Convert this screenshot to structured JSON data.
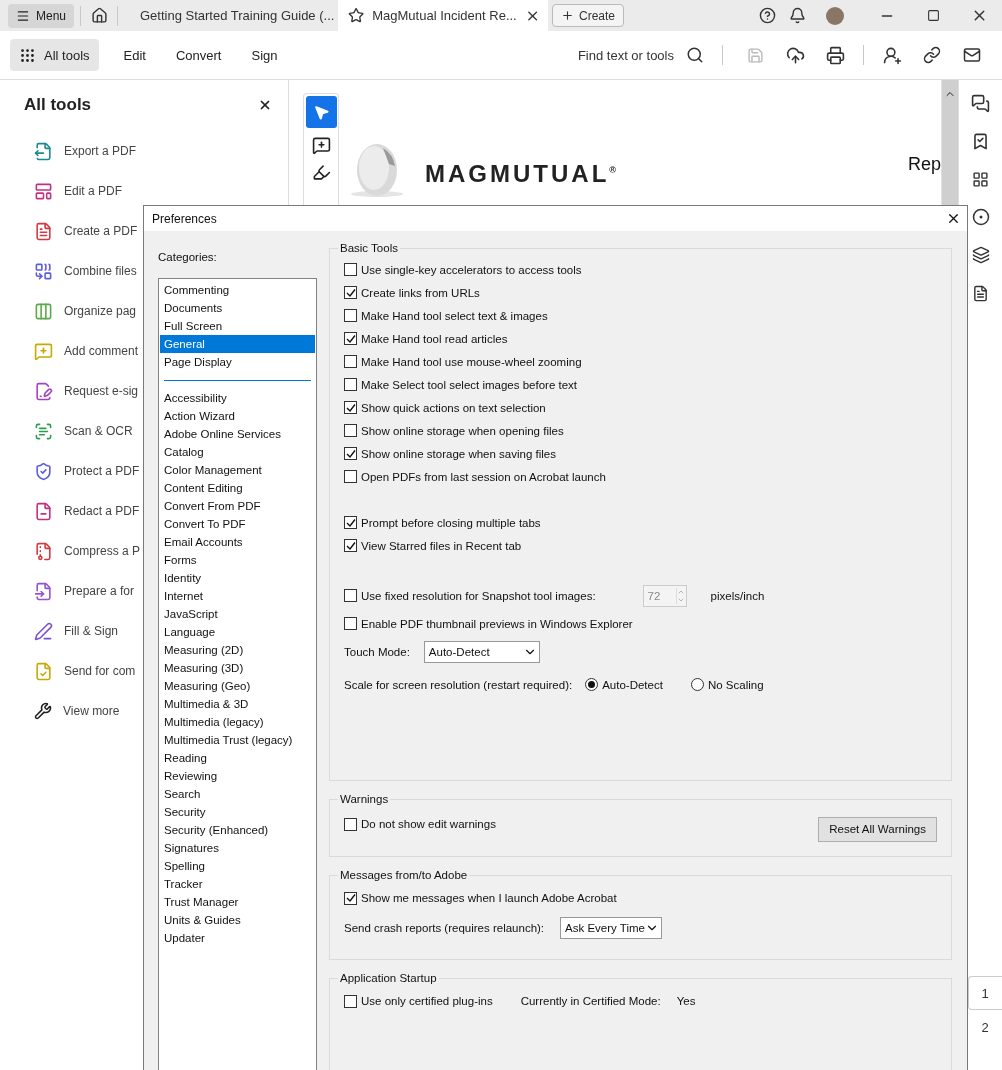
{
  "tab_bar": {
    "menu": "Menu",
    "tabs": [
      {
        "title": "Getting Started Training Guide (...",
        "selected": false
      },
      {
        "title": "MagMutual Incident Re...",
        "selected": true
      }
    ],
    "create": "Create"
  },
  "toolbar": {
    "items": [
      {
        "label": "All tools",
        "selected": true
      },
      {
        "label": "Edit",
        "selected": false
      },
      {
        "label": "Convert",
        "selected": false
      },
      {
        "label": "Sign",
        "selected": false
      }
    ],
    "search": "Find text or tools"
  },
  "tools_panel": {
    "title": "All tools",
    "items": [
      {
        "label": "Export a PDF",
        "color": "#1b8a8f"
      },
      {
        "label": "Edit a PDF",
        "color": "#c2307f"
      },
      {
        "label": "Create a PDF",
        "color": "#d7373f"
      },
      {
        "label": "Combine files",
        "color": "#5c5ce0"
      },
      {
        "label": "Organize pag",
        "color": "#5aa847"
      },
      {
        "label": "Add comment",
        "color": "#c9a800"
      },
      {
        "label": "Request e-sig",
        "color": "#a341c9"
      },
      {
        "label": "Scan & OCR",
        "color": "#2d9d4a"
      },
      {
        "label": "Protect a PDF",
        "color": "#5c5ce0"
      },
      {
        "label": "Redact a PDF",
        "color": "#c2307f"
      },
      {
        "label": "Compress a P",
        "color": "#d7373f"
      },
      {
        "label": "Prepare a for",
        "color": "#9353d3"
      },
      {
        "label": "Fill & Sign",
        "color": "#7a4fd6"
      },
      {
        "label": "Send for com",
        "color": "#c9a800"
      }
    ],
    "view_more": "View more"
  },
  "document": {
    "logo": "MAGMUTUAL$^{®}$",
    "heading": "Rep"
  },
  "page_numbers": [
    {
      "label": "1",
      "selected": true
    },
    {
      "label": "2",
      "selected": false
    }
  ],
  "dialog": {
    "title": "Preferences",
    "categories_label": "Categories:",
    "category_groups": [
      {
        "items": [
          {
            "label": "Commenting",
            "selected": false
          },
          {
            "label": "Documents",
            "selected": false
          },
          {
            "label": "Full Screen",
            "selected": false
          },
          {
            "label": "General",
            "selected": true
          },
          {
            "label": "Page Display",
            "selected": false
          }
        ]
      },
      {
        "items": [
          {
            "label": "Accessibility",
            "selected": false
          },
          {
            "label": "Action Wizard",
            "selected": false
          },
          {
            "label": "Adobe Online Services",
            "selected": false
          },
          {
            "label": "Catalog",
            "selected": false
          },
          {
            "label": "Color Management",
            "selected": false
          },
          {
            "label": "Content Editing",
            "selected": false
          },
          {
            "label": "Convert From PDF",
            "selected": false
          },
          {
            "label": "Convert To PDF",
            "selected": false
          },
          {
            "label": "Email Accounts",
            "selected": false
          },
          {
            "label": "Forms",
            "selected": false
          },
          {
            "label": "Identity",
            "selected": false
          },
          {
            "label": "Internet",
            "selected": false
          },
          {
            "label": "JavaScript",
            "selected": false
          },
          {
            "label": "Language",
            "selected": false
          },
          {
            "label": "Measuring (2D)",
            "selected": false
          },
          {
            "label": "Measuring (3D)",
            "selected": false
          },
          {
            "label": "Measuring (Geo)",
            "selected": false
          },
          {
            "label": "Multimedia & 3D",
            "selected": false
          },
          {
            "label": "Multimedia (legacy)",
            "selected": false
          },
          {
            "label": "Multimedia Trust (legacy)",
            "selected": false
          },
          {
            "label": "Reading",
            "selected": false
          },
          {
            "label": "Reviewing",
            "selected": false
          },
          {
            "label": "Search",
            "selected": false
          },
          {
            "label": "Security",
            "selected": false
          },
          {
            "label": "Security (Enhanced)",
            "selected": false
          },
          {
            "label": "Signatures",
            "selected": false
          },
          {
            "label": "Spelling",
            "selected": false
          },
          {
            "label": "Tracker",
            "selected": false
          },
          {
            "label": "Trust Manager",
            "selected": false
          },
          {
            "label": "Units & Guides",
            "selected": false
          },
          {
            "label": "Updater",
            "selected": false
          }
        ]
      }
    ],
    "basic_tools": {
      "title": "Basic Tools",
      "sections": [
        {
          "items": [
            {
              "kind": "checkbox",
              "label": "Use single-key accelerators to access tools",
              "checked": false
            },
            {
              "kind": "checkbox",
              "label": "Create links from URLs",
              "checked": true
            },
            {
              "kind": "checkbox",
              "label": "Make Hand tool select text & images",
              "checked": false
            },
            {
              "kind": "checkbox",
              "label": "Make Hand tool read articles",
              "checked": true
            },
            {
              "kind": "checkbox",
              "label": "Make Hand tool use mouse-wheel zooming",
              "checked": false
            },
            {
              "kind": "checkbox",
              "label": "Make Select tool select images before text",
              "checked": false
            },
            {
              "kind": "checkbox",
              "label": "Show quick actions on text selection",
              "checked": true
            },
            {
              "kind": "checkbox",
              "label": "Show online storage when opening files",
              "checked": false
            },
            {
              "kind": "checkbox",
              "label": "Show online storage when saving files",
              "checked": true
            },
            {
              "kind": "checkbox",
              "label": "Open PDFs from last session on Acrobat launch",
              "checked": false
            }
          ]
        },
        {
          "items": [
            {
              "kind": "checkbox",
              "label": "Prompt before closing multiple tabs",
              "checked": true
            },
            {
              "kind": "checkbox",
              "label": "View Starred files in Recent tab",
              "checked": true
            }
          ]
        },
        {
          "items": [
            {
              "kind": "number",
              "label": "Use fixed resolution for Snapshot tool images:",
              "checked": false,
              "value": "72",
              "disabled": true,
              "unit": "pixels/inch"
            },
            {
              "kind": "checkbox",
              "label": "Enable PDF thumbnail previews in Windows Explorer",
              "checked": false
            },
            {
              "kind": "select",
              "label": "Touch Mode:",
              "value": "Auto-Detect"
            },
            {
              "kind": "radio",
              "label": "Scale for screen resolution (restart required):",
              "options": [
                {
                  "label": "Auto-Detect",
                  "selected": true
                },
                {
                  "label": "No Scaling",
                  "selected": false
                }
              ]
            }
          ]
        }
      ]
    },
    "warnings": {
      "title": "Warnings",
      "checkbox": {
        "label": "Do not show edit warnings",
        "checked": false
      },
      "button": "Reset All Warnings"
    },
    "messages": {
      "title": "Messages from/to Adobe",
      "checkbox": {
        "label": "Show me messages when I launch Adobe Acrobat",
        "checked": true
      },
      "crash_label": "Send crash reports (requires relaunch):",
      "crash_value": "Ask Every Time"
    },
    "startup": {
      "title": "Application Startup",
      "checkbox": {
        "label": "Use only certified plug-ins",
        "checked": false
      },
      "mode_label": "Currently in Certified Mode:",
      "mode_value": "Yes"
    }
  }
}
